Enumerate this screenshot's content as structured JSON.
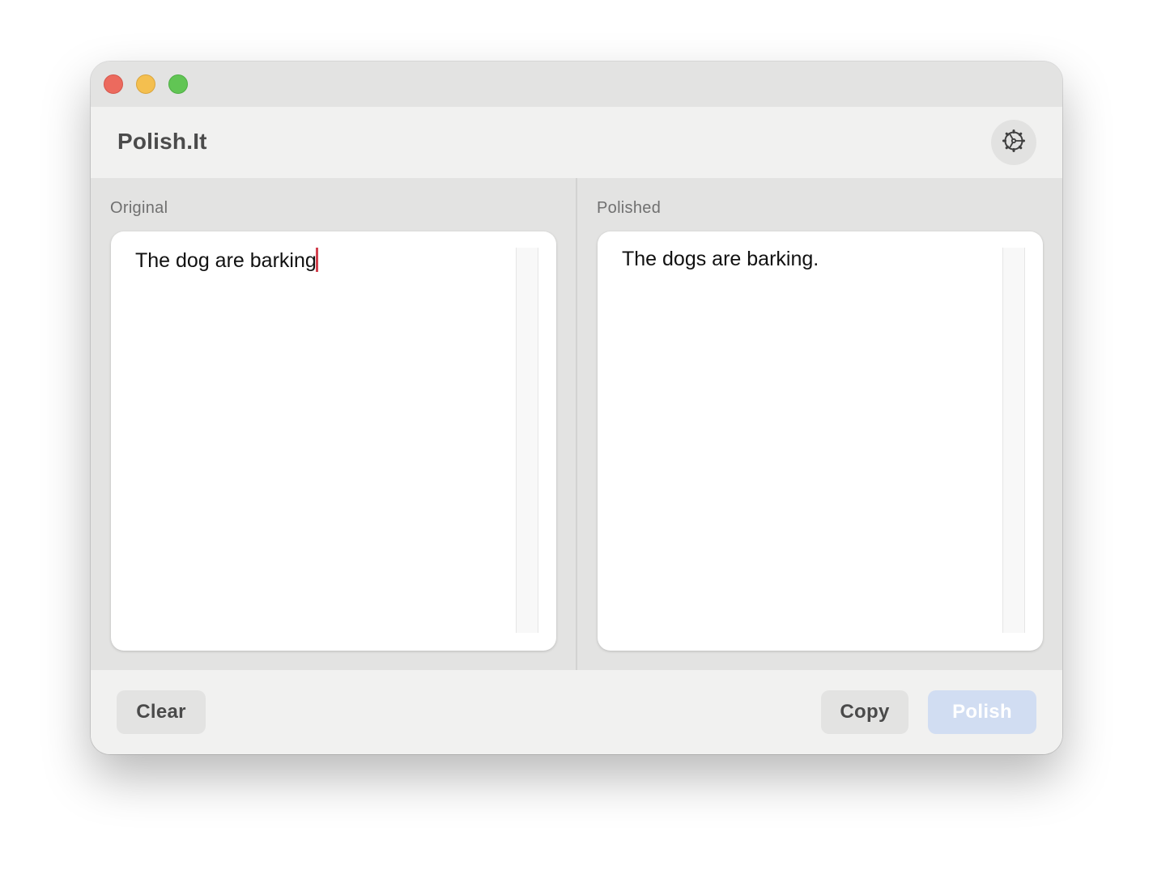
{
  "app": {
    "title": "Polish.It"
  },
  "window_controls": {
    "close_color": "#ec6a5e",
    "minimize_color": "#f4bf4f",
    "zoom_color": "#61c554"
  },
  "header": {
    "settings_icon": "gear-icon"
  },
  "panes": {
    "original": {
      "label": "Original",
      "text": "The dog are barking"
    },
    "polished": {
      "label": "Polished",
      "text": "The dogs are barking."
    }
  },
  "footer": {
    "clear_label": "Clear",
    "copy_label": "Copy",
    "polish_label": "Polish",
    "polish_button_color": "#d1ddf2"
  }
}
